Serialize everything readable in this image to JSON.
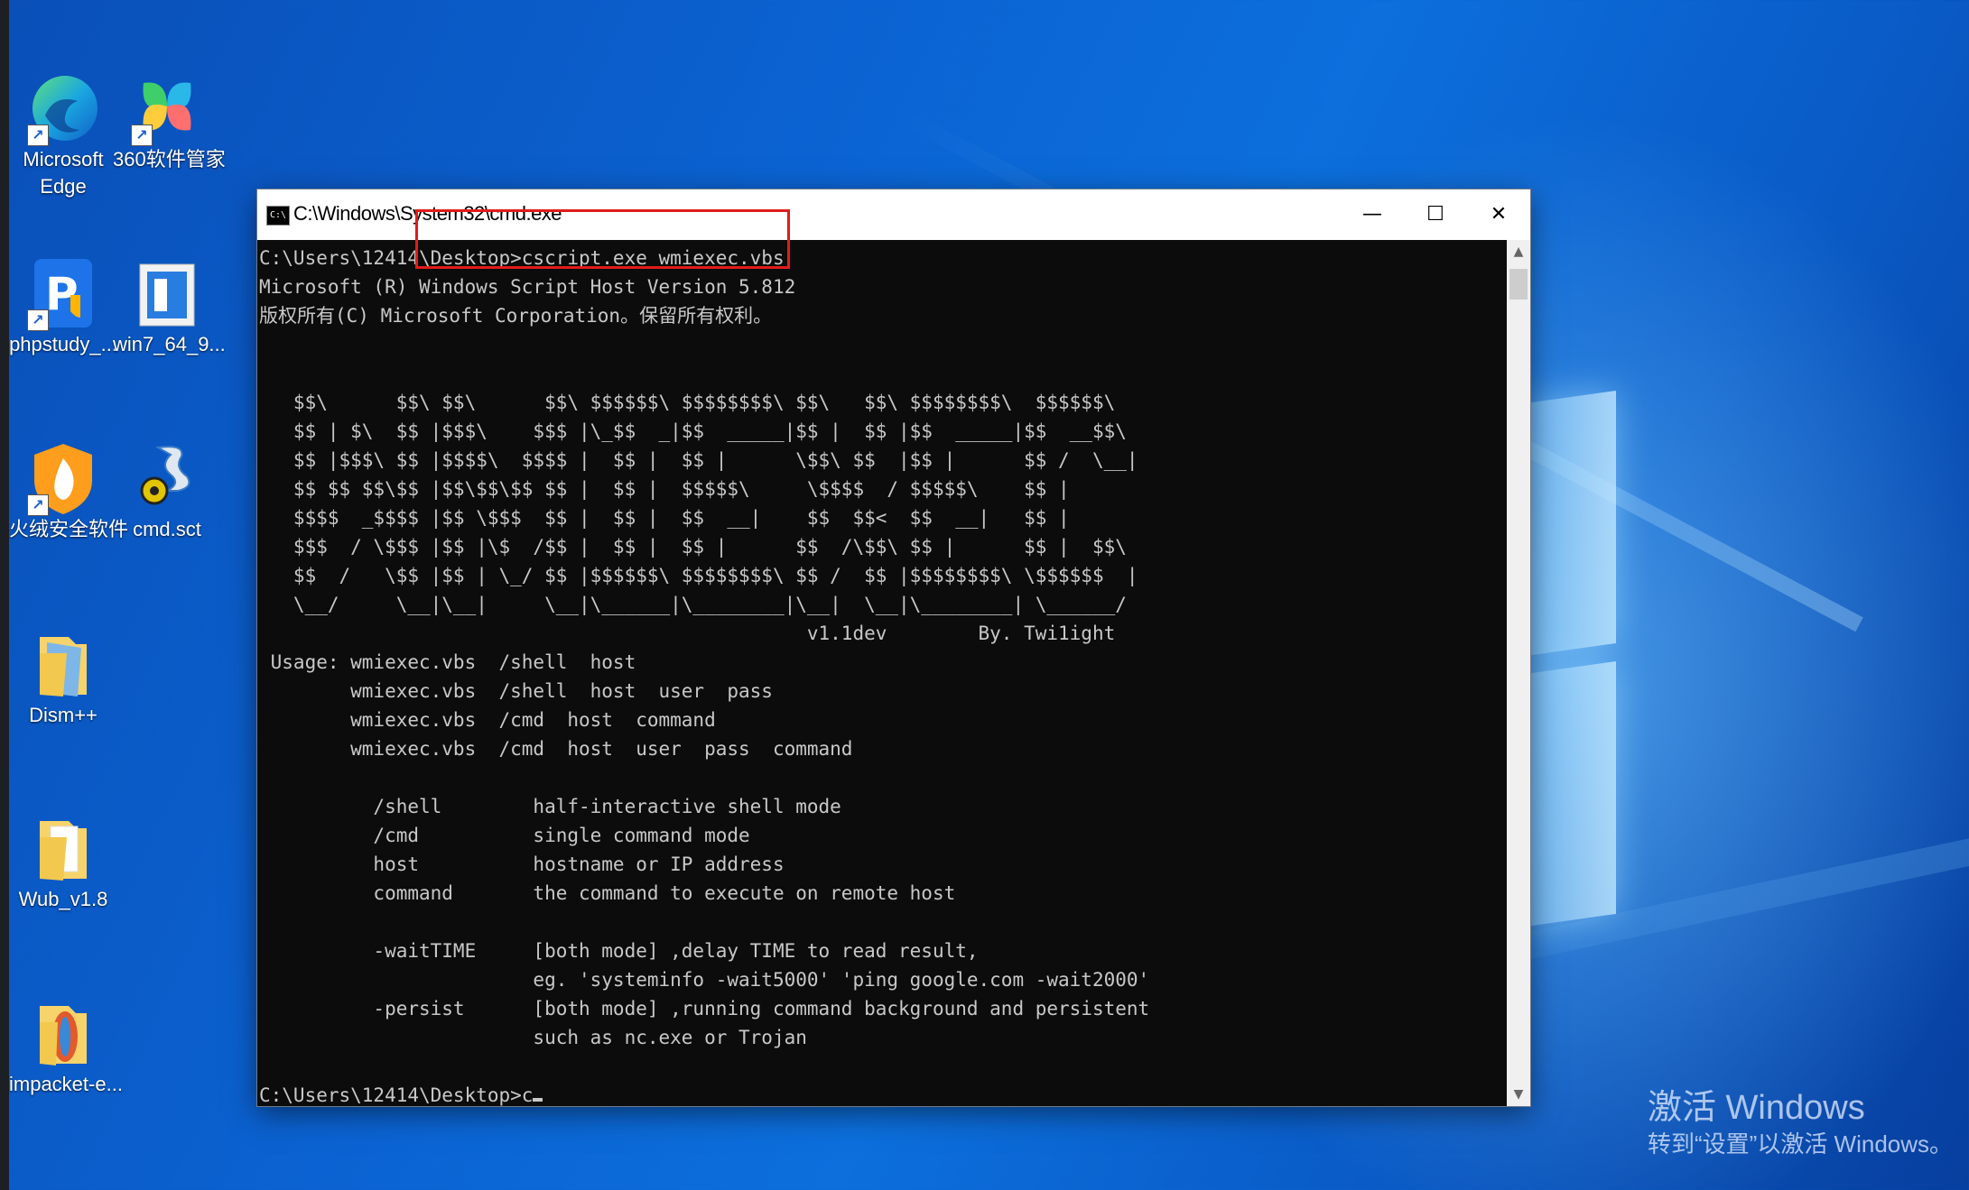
{
  "desktop": {
    "icons": [
      {
        "label": "Microsoft\nEdge"
      },
      {
        "label": "360软件管家"
      },
      {
        "label": "phpstudy_..."
      },
      {
        "label": "win7_64_9..."
      },
      {
        "label": "火绒安全软件"
      },
      {
        "label": "cmd.sct"
      },
      {
        "label": "Dism++"
      },
      {
        "label": "Wub_v1.8"
      },
      {
        "label": "impacket-e..."
      }
    ],
    "activation": {
      "line1": "激活 Windows",
      "line2": "转到“设置”以激活 Windows。"
    }
  },
  "window": {
    "title": "C:\\Windows\\System32\\cmd.exe",
    "icon_text": "C:\\",
    "minimize": "—",
    "maximize": "☐",
    "close": "✕"
  },
  "console": {
    "text": "C:\\Users\\12414\\Desktop>cscript.exe wmiexec.vbs\nMicrosoft (R) Windows Script Host Version 5.812\n版权所有(C) Microsoft Corporation。保留所有权利。\n\n\n   $$\\      $$\\ $$\\      $$\\ $$$$$$\\ $$$$$$$$\\ $$\\   $$\\ $$$$$$$$\\  $$$$$$\\\n   $$ | $\\  $$ |$$$\\    $$$ |\\_$$  _|$$  _____|$$ |  $$ |$$  _____|$$  __$$\\\n   $$ |$$$\\ $$ |$$$$\\  $$$$ |  $$ |  $$ |      \\$$\\ $$  |$$ |      $$ /  \\__|\n   $$ $$ $$\\$$ |$$\\$$\\$$ $$ |  $$ |  $$$$$\\     \\$$$$  / $$$$$\\    $$ |\n   $$$$  _$$$$ |$$ \\$$$  $$ |  $$ |  $$  __|    $$  $$<  $$  __|   $$ |\n   $$$  / \\$$$ |$$ |\\$  /$$ |  $$ |  $$ |      $$  /\\$$\\ $$ |      $$ |  $$\\\n   $$  /   \\$$ |$$ | \\_/ $$ |$$$$$$\\ $$$$$$$$\\ $$ /  $$ |$$$$$$$$\\ \\$$$$$$  |\n   \\__/     \\__|\\__|     \\__|\\______|\\________|\\__|  \\__|\\________| \\______/\n                                                v1.1dev        By. Twi1ight\n Usage: wmiexec.vbs  /shell  host\n        wmiexec.vbs  /shell  host  user  pass\n        wmiexec.vbs  /cmd  host  command\n        wmiexec.vbs  /cmd  host  user  pass  command\n\n          /shell        half-interactive shell mode\n          /cmd          single command mode\n          host          hostname or IP address\n          command       the command to execute on remote host\n\n          -waitTIME     [both mode] ,delay TIME to read result,\n                        eg. 'systeminfo -wait5000' 'ping google.com -wait2000'\n          -persist      [both mode] ,running command background and persistent\n                        such as nc.exe or Trojan\n\n",
    "prompt": "C:\\Users\\12414\\Desktop>c"
  },
  "colors": {
    "desktop_blue": "#0b63d2",
    "console_bg": "#0c0c0c",
    "console_fg": "#c8c8c8",
    "highlight_red": "#e21b1b"
  }
}
